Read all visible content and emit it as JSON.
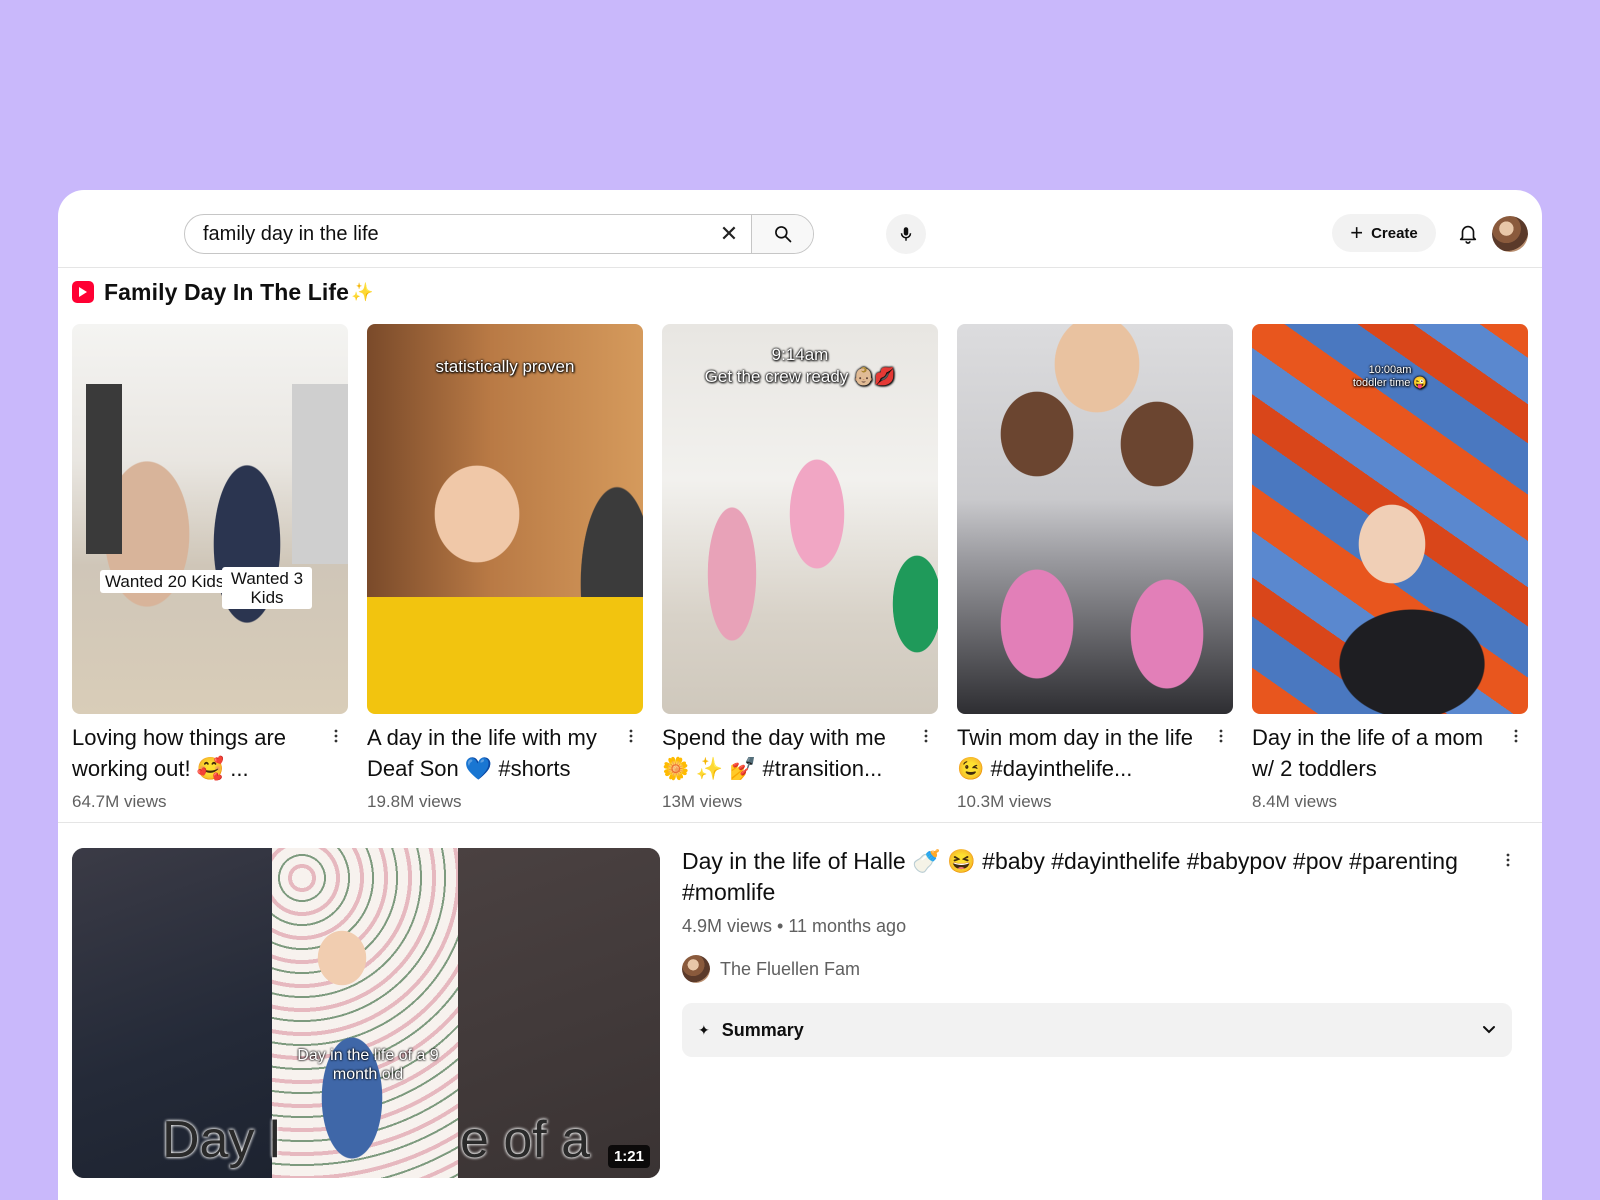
{
  "search": {
    "query": "family day in the life",
    "clear_icon": "close-icon",
    "search_icon": "search-icon",
    "mic_icon": "mic-icon"
  },
  "header": {
    "create_label": "Create",
    "bell_icon": "bell-icon"
  },
  "shelf": {
    "title": "Family Day In The Life",
    "title_suffix": "✨",
    "shorts": [
      {
        "title": "Loving how things are working out! 🥰 ...",
        "views": "64.7M views",
        "overlay": [
          "Wanted 20 Kids",
          "Wanted 3 Kids"
        ]
      },
      {
        "title": "A day in the life with my Deaf Son 💙  #shorts",
        "views": "19.8M views",
        "overlay": [
          "statistically proven"
        ]
      },
      {
        "title": "Spend the day with me 🌼 ✨ 💅 #transition...",
        "views": "13M views",
        "overlay": [
          "9:14am",
          "Get the crew ready 👶🏼💋"
        ]
      },
      {
        "title": "Twin mom day in the life 😉  #dayinthelife...",
        "views": "10.3M views",
        "overlay": []
      },
      {
        "title": "Day in the life of a mom w/ 2 toddlers",
        "views": "8.4M views",
        "overlay": [
          "10:00am",
          "toddler time 😜"
        ]
      }
    ]
  },
  "video": {
    "title": "Day in the life of Halle 🍼 😆  #baby #dayinthelife #babypov #pov #parenting #momlife",
    "meta": "4.9M views • 11 months ago",
    "channel": "The Fluellen Fam",
    "duration": "1:21",
    "thumb_caption": "Day in the life of a 9 month old",
    "thumb_big_left": "Day l",
    "thumb_big_right": "e of a",
    "summary_label": "Summary"
  },
  "colors": {
    "background": "#c9b8fb",
    "brand_red": "#ff0033"
  }
}
